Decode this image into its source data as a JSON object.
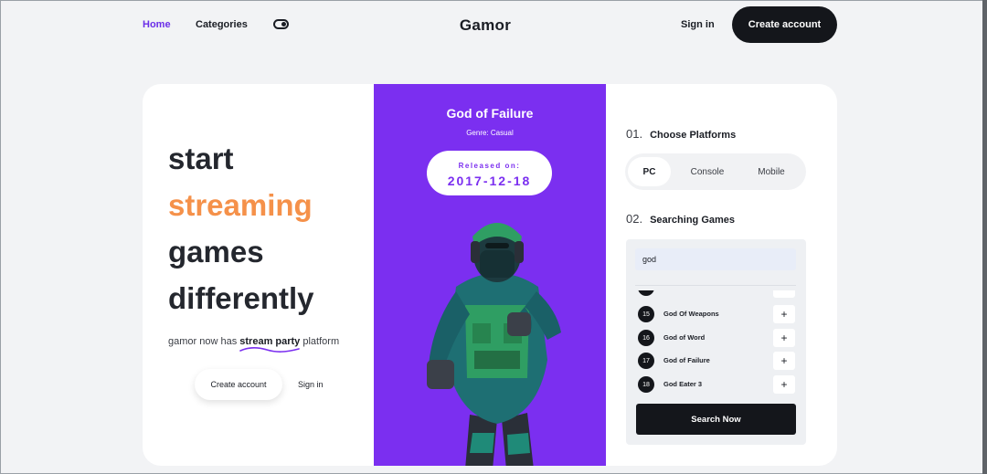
{
  "nav": {
    "home": "Home",
    "categories": "Categories",
    "brand": "Gamor",
    "sign_in": "Sign in",
    "create_account": "Create account"
  },
  "hero": {
    "line1": "start",
    "line2": "streaming",
    "line3": "games",
    "line4": "differently",
    "tagline_before": "gamor now has ",
    "tagline_highlight": "stream party",
    "tagline_after": " platform",
    "create_account": "Create account",
    "sign_in": "Sign in"
  },
  "featured": {
    "title": "God of Failure",
    "genre": "Genre: Casual",
    "released_label": "Released on:",
    "released_date": "2017-12-18"
  },
  "platforms": {
    "step_num": "01.",
    "title": "Choose Platforms",
    "options": [
      "PC",
      "Console",
      "Mobile"
    ],
    "selected": "PC"
  },
  "search": {
    "step_num": "02.",
    "title": "Searching Games",
    "query": "god",
    "results": [
      {
        "num": "15",
        "name": "God Of Weapons",
        "action": "+"
      },
      {
        "num": "16",
        "name": "God of Word",
        "action": "+"
      },
      {
        "num": "17",
        "name": "God of Failure",
        "action": "+"
      },
      {
        "num": "18",
        "name": "God Eater 3",
        "action": "+"
      }
    ],
    "button": "Search Now"
  },
  "colors": {
    "accent_purple": "#7b2ff0",
    "accent_orange": "#f5914a",
    "dark": "#14161b"
  }
}
